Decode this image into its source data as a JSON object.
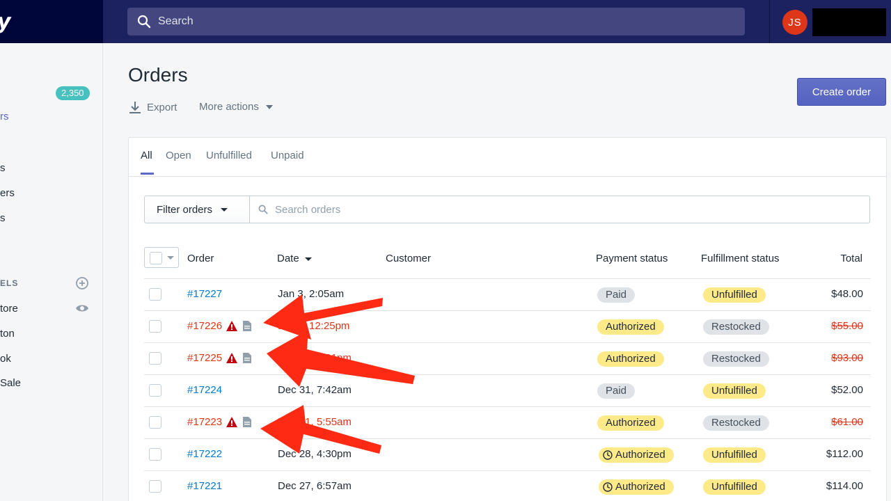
{
  "header": {
    "brand_glyph": "y",
    "search_placeholder": "Search",
    "avatar_initials": "JS"
  },
  "sidebar": {
    "orders_badge": "2,350",
    "items": [
      {
        "label": "rs",
        "active": true
      },
      {
        "label": "s"
      },
      {
        "label": "ers"
      },
      {
        "label": "s"
      }
    ],
    "channels_section": "ELS",
    "channels": [
      {
        "label": "tore"
      },
      {
        "label": "ton"
      },
      {
        "label": "ok"
      },
      {
        "label": "Sale"
      }
    ],
    "icons": {
      "add": "plus-circle-icon",
      "view": "eye-icon"
    }
  },
  "page": {
    "title": "Orders",
    "export_label": "Export",
    "more_actions_label": "More actions",
    "create_order_label": "Create order"
  },
  "tabs": [
    {
      "label": "All",
      "active": true
    },
    {
      "label": "Open"
    },
    {
      "label": "Unfulfilled"
    },
    {
      "label": "Unpaid"
    }
  ],
  "filter": {
    "button_label": "Filter orders",
    "search_placeholder": "Search orders"
  },
  "table": {
    "columns": {
      "order": "Order",
      "date": "Date",
      "customer": "Customer",
      "payment": "Payment status",
      "fulfillment": "Fulfillment status",
      "total": "Total"
    },
    "rows": [
      {
        "order": "#17227",
        "date": "Jan 3, 2:05am",
        "payment": "Paid",
        "payment_style": "grey",
        "fulfillment": "Unfulfilled",
        "fulfillment_style": "yellow",
        "total": "$48.00",
        "flagged": false,
        "refunded": false,
        "clock": false
      },
      {
        "order": "#17226",
        "date": "Jan 3, 12:25pm",
        "payment": "Authorized",
        "payment_style": "yellow",
        "fulfillment": "Restocked",
        "fulfillment_style": "grey",
        "total": "$55.00",
        "flagged": true,
        "refunded": true,
        "clock": false
      },
      {
        "order": "#17225",
        "date": "Dec 31, 4:01pm",
        "payment": "Authorized",
        "payment_style": "yellow",
        "fulfillment": "Restocked",
        "fulfillment_style": "grey",
        "total": "$93.00",
        "flagged": true,
        "refunded": true,
        "clock": false
      },
      {
        "order": "#17224",
        "date": "Dec 31, 7:42am",
        "payment": "Paid",
        "payment_style": "grey",
        "fulfillment": "Unfulfilled",
        "fulfillment_style": "yellow",
        "total": "$52.00",
        "flagged": false,
        "refunded": false,
        "clock": false
      },
      {
        "order": "#17223",
        "date": "Dec 31, 5:55am",
        "payment": "Authorized",
        "payment_style": "yellow",
        "fulfillment": "Restocked",
        "fulfillment_style": "grey",
        "total": "$61.00",
        "flagged": true,
        "refunded": true,
        "clock": false
      },
      {
        "order": "#17222",
        "date": "Dec 28, 4:30pm",
        "payment": "Authorized",
        "payment_style": "yellow",
        "fulfillment": "Unfulfilled",
        "fulfillment_style": "yellow",
        "total": "$112.00",
        "flagged": false,
        "refunded": false,
        "clock": true
      },
      {
        "order": "#17221",
        "date": "Dec 27, 6:57am",
        "payment": "Authorized",
        "payment_style": "yellow",
        "fulfillment": "Unfulfilled",
        "fulfillment_style": "yellow",
        "total": "$114.00",
        "flagged": false,
        "refunded": false,
        "clock": true
      }
    ]
  },
  "colors": {
    "topbar": "#1c2260",
    "accent": "#5c6ac4",
    "link": "#007ace",
    "danger": "#de3618",
    "annotation_arrow": "#ff2a14",
    "badge_yellow": "#ffea8a",
    "badge_grey": "#dfe3e8",
    "badge_teal": "#47c1bf"
  }
}
